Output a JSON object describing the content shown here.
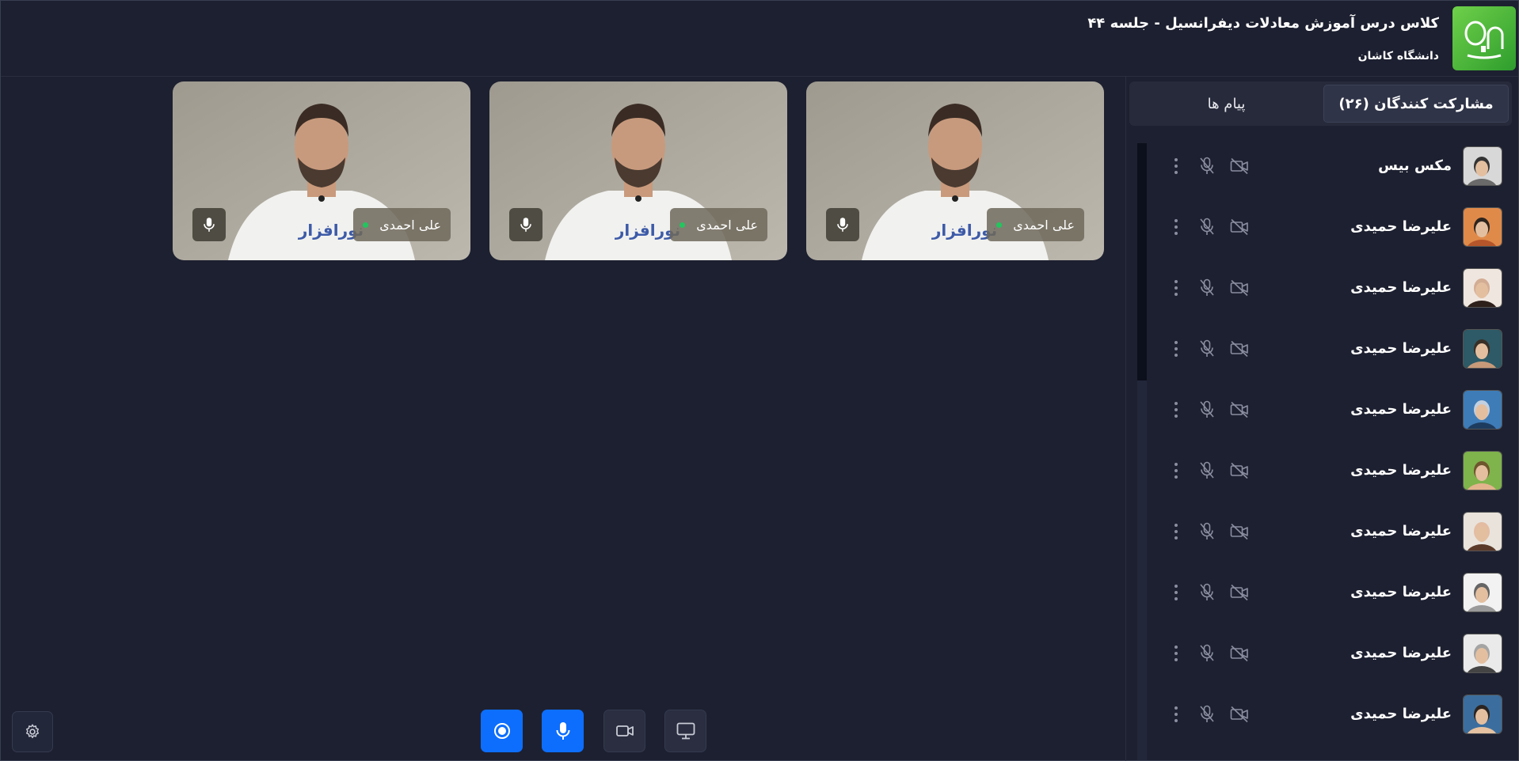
{
  "header": {
    "title": "کلاس درس آموزش معادلات دیفرانسیل - جلسه ۴۴",
    "subtitle": "دانشگاه کاشان",
    "logo_text": "On"
  },
  "sidebar": {
    "tabs": [
      {
        "label": "مشارکت کنندگان (۲۶)",
        "active": true
      },
      {
        "label": "پیام ها",
        "active": false
      }
    ],
    "participants": [
      {
        "name": "مکس بیس",
        "avatar": "sketch-portrait"
      },
      {
        "name": "علیرضا حمیدی",
        "avatar": "man-sunglasses"
      },
      {
        "name": "علیرضا حمیدی",
        "avatar": "woman-dark-hair"
      },
      {
        "name": "علیرضا حمیدی",
        "avatar": "child-portrait"
      },
      {
        "name": "علیرضا حمیدی",
        "avatar": "blue-portrait"
      },
      {
        "name": "علیرضا حمیدی",
        "avatar": "boy-outdoor"
      },
      {
        "name": "علیرضا حمیدی",
        "avatar": "woman-smiling"
      },
      {
        "name": "علیرضا حمیدی",
        "avatar": "grey-face"
      },
      {
        "name": "علیرضا حمیدی",
        "avatar": "man-cap"
      },
      {
        "name": "علیرضا حمیدی",
        "avatar": "man-smiling"
      }
    ]
  },
  "video_tiles": [
    {
      "name": "علی احمدی",
      "status": "live"
    },
    {
      "name": "علی احمدی",
      "status": "live"
    },
    {
      "name": "علی احمدی",
      "status": "live"
    }
  ],
  "controls": {
    "record": "record-icon",
    "mic": "mic-icon",
    "camera": "camera-icon",
    "screen": "screen-share-icon",
    "settings": "gear-icon"
  },
  "colors": {
    "background": "#1d2030",
    "accent": "#0d6efd",
    "live": "#22c55e",
    "logo": "#4fbf3a"
  }
}
